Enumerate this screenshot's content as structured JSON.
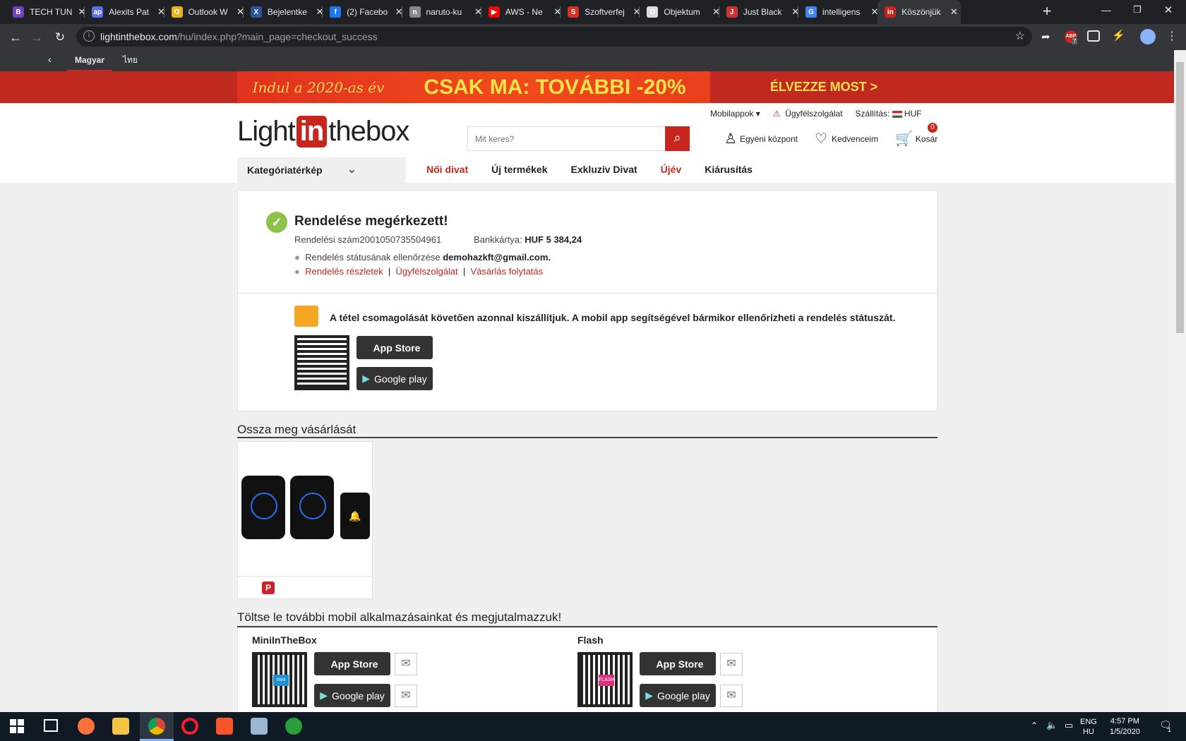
{
  "browser": {
    "tabs": [
      {
        "title": "TECH TUN",
        "fav": "B",
        "color": "#6f42c1"
      },
      {
        "title": "Alexits Pat",
        "fav": "ap",
        "color": "#5b6fe8"
      },
      {
        "title": "Outlook W",
        "fav": "O",
        "color": "#e7b41a"
      },
      {
        "title": "Bejelentke",
        "fav": "X",
        "color": "#2b579a"
      },
      {
        "title": "(2) Facebo",
        "fav": "f",
        "color": "#1877f2"
      },
      {
        "title": "naruto-ku",
        "fav": "n",
        "color": "#888888"
      },
      {
        "title": "AWS - Ne",
        "fav": "▶",
        "color": "#ff0000"
      },
      {
        "title": "Szoftverfej",
        "fav": "S",
        "color": "#d93025"
      },
      {
        "title": "Objektum",
        "fav": "O",
        "color": "#dddddd"
      },
      {
        "title": "Just Black",
        "fav": "J",
        "color": "#cc3333"
      },
      {
        "title": "intelligens",
        "fav": "G",
        "color": "#4285f4"
      },
      {
        "title": "Köszönjük",
        "fav": "in",
        "color": "#c8261c"
      }
    ],
    "new_tab": "+",
    "url_domain": "lightinthebox.com",
    "url_rest": "/hu/index.php?main_page=checkout_success",
    "ext_badge": "7"
  },
  "langbar": {
    "active": "Magyar",
    "other": "ไทย"
  },
  "banner": {
    "left": "Indul a 2020-as év",
    "middle": "CSAK MA: TOVÁBBI -20%",
    "right": "ÉLVEZZE MOST >"
  },
  "header": {
    "logo_left": "Light",
    "logo_mid": "in",
    "logo_right": "thebox",
    "top_links": {
      "apps": "Mobilappok",
      "support": "Ügyfélszolgálat",
      "shipping": "Szállítás:",
      "currency": "HUF"
    },
    "search_placeholder": "Mit keres?",
    "account": "Egyéni központ",
    "favorites": "Kedvenceim",
    "cart": "Kosár",
    "cart_count": "0",
    "category_map": "Kategóriatérkép",
    "nav": [
      {
        "label": "Női divat",
        "color": "#c8261c"
      },
      {
        "label": "Új termékek",
        "color": "#222222"
      },
      {
        "label": "Exkluzív Divat",
        "color": "#222222"
      },
      {
        "label": "Újév",
        "color": "#c8261c"
      },
      {
        "label": "Kiárusítás",
        "color": "#222222"
      }
    ]
  },
  "order": {
    "title": "Rendelése megérkezett!",
    "number_label": "Rendelési szám",
    "number": "2001050735504961",
    "payment_label": "Bankkártya:",
    "payment_value": "HUF 5 384,24",
    "status_text": "Rendelés státusának ellenőrzése",
    "email": "demohazkft@gmail.com.",
    "links": [
      "Rendelés részletek",
      "Ügyfélszolgálat",
      "Vásárlás folytatás"
    ],
    "separator": "|",
    "app_message": "A tétel csomagolását követően azonnal kiszállítjuk. A mobil app segítségével bármikor ellenőrizheti a rendelés státuszát.",
    "app_store": "App Store",
    "google_play": "Google play"
  },
  "share": {
    "title": "Ossza meg vásárlását"
  },
  "apps": {
    "title": "Töltse le további mobil alkalmazásainkat és megjutalmazzuk!",
    "items": [
      {
        "name": "MiniInTheBox",
        "badge": "mini",
        "badge_color": "#1e90d6"
      },
      {
        "name": "Flash",
        "badge": "FLASH",
        "badge_color": "#e0307a"
      }
    ]
  },
  "taskbar": {
    "lang1": "ENG",
    "lang2": "HU",
    "time": "4:57 PM",
    "date": "1/5/2020",
    "notif": "1"
  }
}
